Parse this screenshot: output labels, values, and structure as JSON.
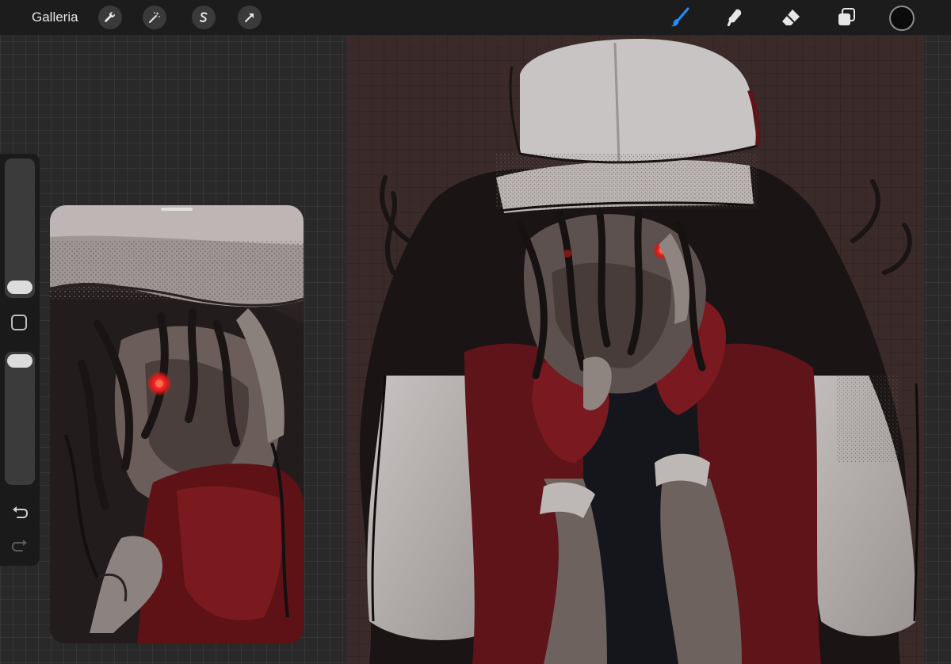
{
  "toolbar": {
    "gallery_label": "Galleria",
    "left_tools": [
      {
        "name": "wrench-icon"
      },
      {
        "name": "magic-wand-icon"
      },
      {
        "name": "selection-s-icon"
      },
      {
        "name": "transform-arrow-icon"
      }
    ],
    "right_tools": [
      {
        "name": "brush-icon",
        "active": true,
        "color": "#1e90ff"
      },
      {
        "name": "smudge-icon"
      },
      {
        "name": "eraser-icon"
      },
      {
        "name": "layers-icon"
      }
    ],
    "current_color": "#0b0b0b"
  },
  "sidebar": {
    "brush_size_level": 0.1,
    "opacity_level": 1.0,
    "icons": [
      "modify-square-icon",
      "undo-icon",
      "redo-icon"
    ]
  },
  "colors": {
    "toolbar_bg": "#1c1c1c",
    "workspace_bg": "#292929",
    "canvas_bg": "#3b2a2a",
    "accent_blue": "#1e90ff",
    "eye_red": "#ff2a2a",
    "vest_red": "#6b1418",
    "cap_white": "#c9c4c4"
  }
}
